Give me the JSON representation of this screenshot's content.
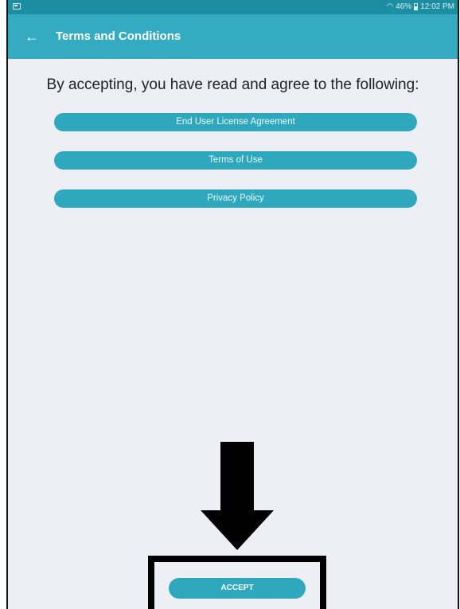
{
  "status_bar": {
    "battery": "46%",
    "time": "12:02 PM"
  },
  "app_bar": {
    "back_icon": "←",
    "title": "Terms and Conditions"
  },
  "content": {
    "heading": "By accepting, you have read and agree to the following:",
    "buttons": [
      {
        "label": "End User License Agreement"
      },
      {
        "label": "Terms of Use"
      },
      {
        "label": "Privacy Policy"
      }
    ]
  },
  "accept": {
    "label": "ACCEPT"
  },
  "colors": {
    "status_bar": "#1d8ea1",
    "app_bar": "#34abc0",
    "button": "#2fa8be",
    "background": "#eeeff4"
  }
}
